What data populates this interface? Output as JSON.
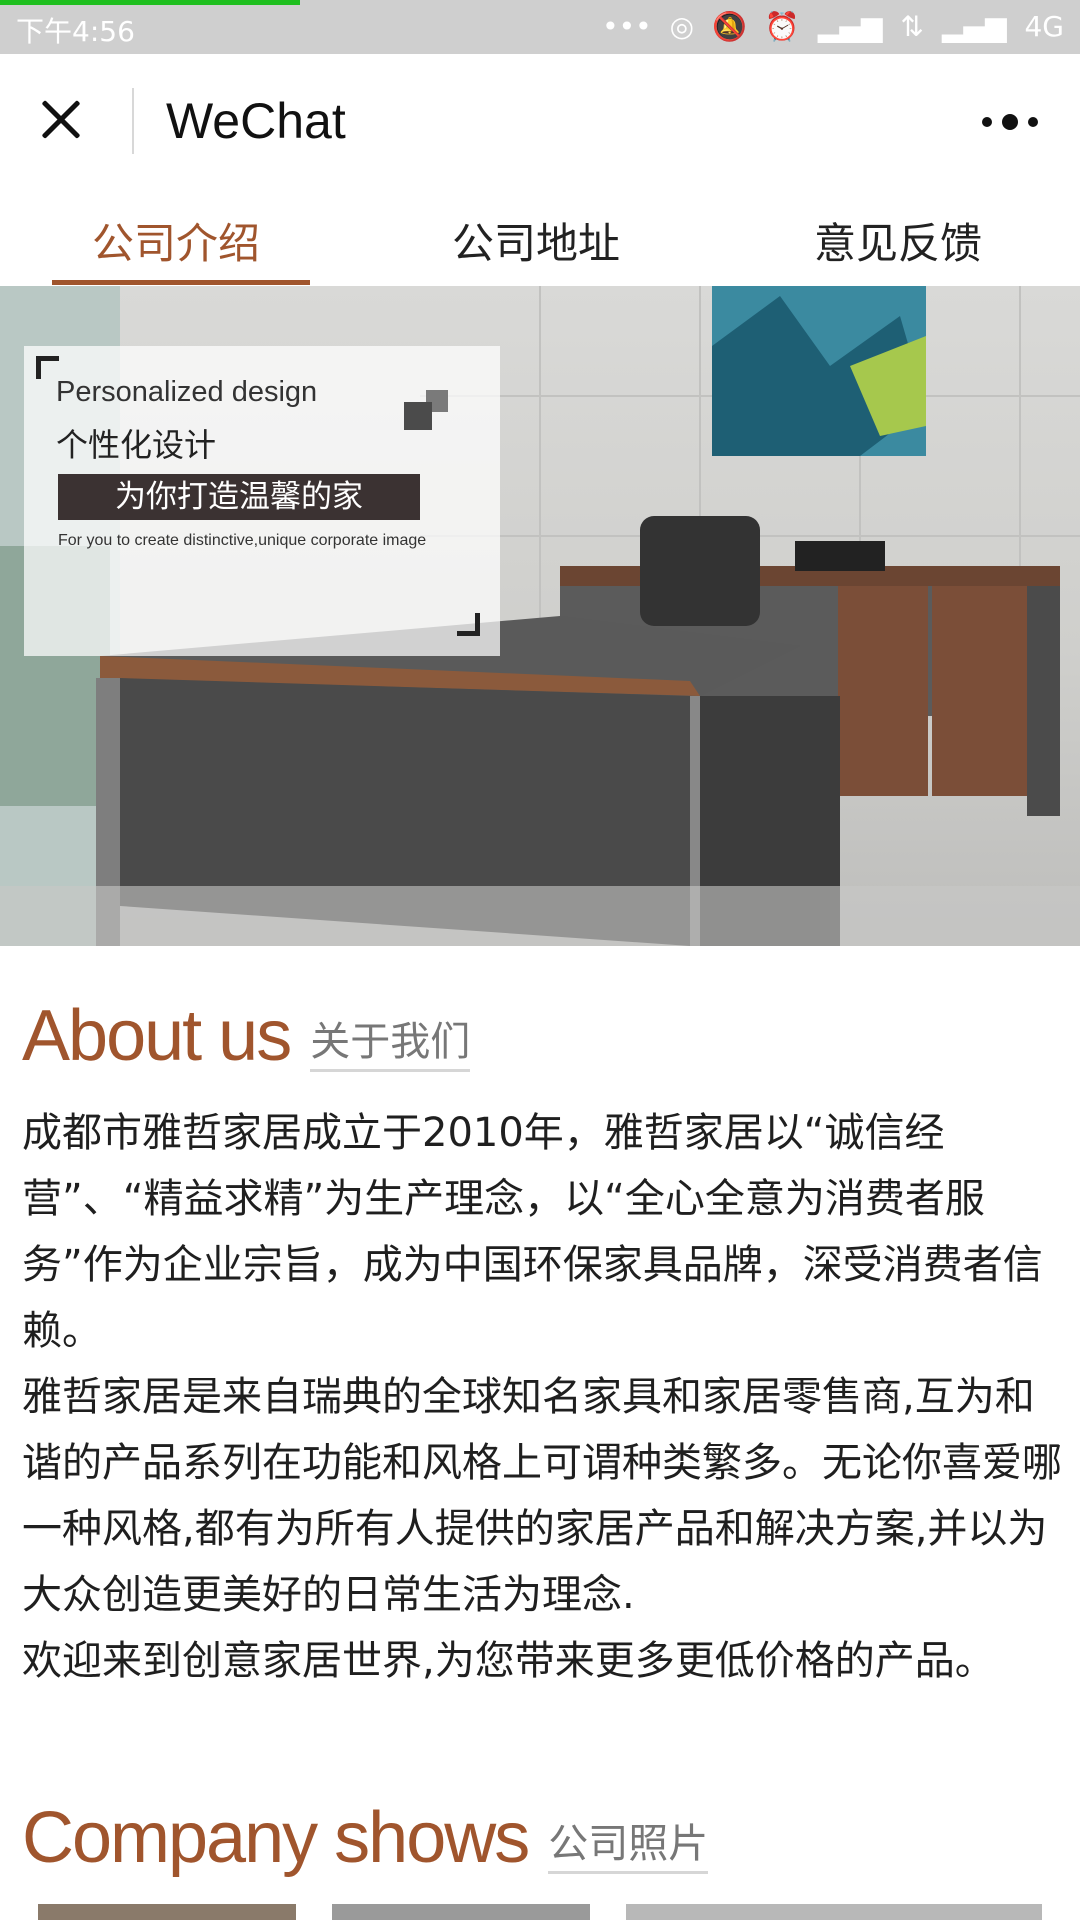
{
  "status_bar": {
    "time": "下午4:56",
    "network": "4G",
    "page_load_progress": 0.34
  },
  "title_bar": {
    "title": "WeChat",
    "close_icon": "close-icon",
    "more_icon": "more-icon"
  },
  "tabs": [
    {
      "label": "公司介绍",
      "active": true
    },
    {
      "label": "公司地址",
      "active": false
    },
    {
      "label": "意见反馈",
      "active": false
    }
  ],
  "hero": {
    "en_title": "Personalized design",
    "cn_title": "个性化设计",
    "slogan": "为你打造温馨的家",
    "caption": "For you to create distinctive,unique corporate image"
  },
  "about": {
    "heading_en": "About us",
    "heading_cn": "关于我们",
    "paragraphs": [
      "成都市雅哲家居成立于2010年，雅哲家居以“诚信经营”、“精益求精”为生产理念，以“全心全意为消费者服务”作为企业宗旨，成为中国环保家具品牌，深受消费者信赖。",
      "雅哲家居是来自瑞典的全球知名家具和家居零售商,互为和谐的产品系列在功能和风格上可谓种类繁多。无论你喜爱哪一种风格,都有为所有人提供的家居产品和解决方案,并以为大众创造更美好的日常生活为理念.",
      "欢迎来到创意家居世界,为您带来更多更低价格的产品。"
    ]
  },
  "company_shows": {
    "heading_en": "Company shows",
    "heading_cn": "公司照片"
  },
  "colors": {
    "accent": "#a0552d",
    "status_bar": "#cfcfcf",
    "progress": "#1fbf1f"
  }
}
